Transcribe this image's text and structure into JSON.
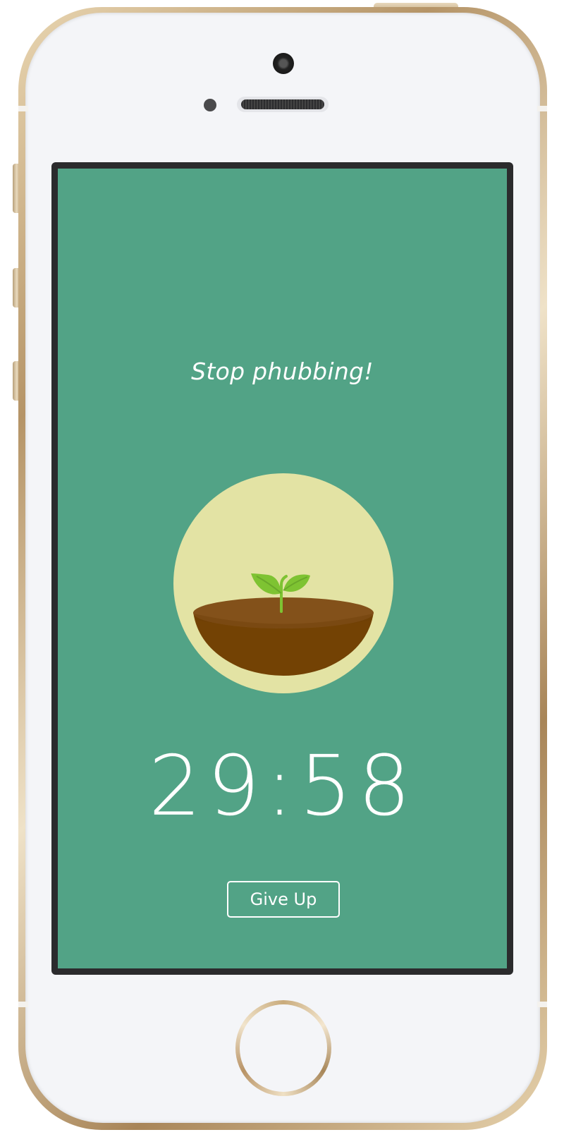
{
  "device": {
    "model": "iPhone 5s",
    "finish": "gold",
    "colors": {
      "body": "#f4f5f8",
      "trim": "#c9ab7c",
      "bezel": "#2b2b2d"
    }
  },
  "app": {
    "background_color": "#52a386",
    "message": "Stop phubbing!",
    "illustration": {
      "name": "sprout-in-soil-icon",
      "circle_color": "#e3e3a4",
      "soil_top_color": "#83511a",
      "soil_color": "#734204",
      "leaf_color": "#7ec332"
    },
    "timer": {
      "remaining": "29:58"
    },
    "give_up_button": {
      "label": "Give Up"
    }
  }
}
